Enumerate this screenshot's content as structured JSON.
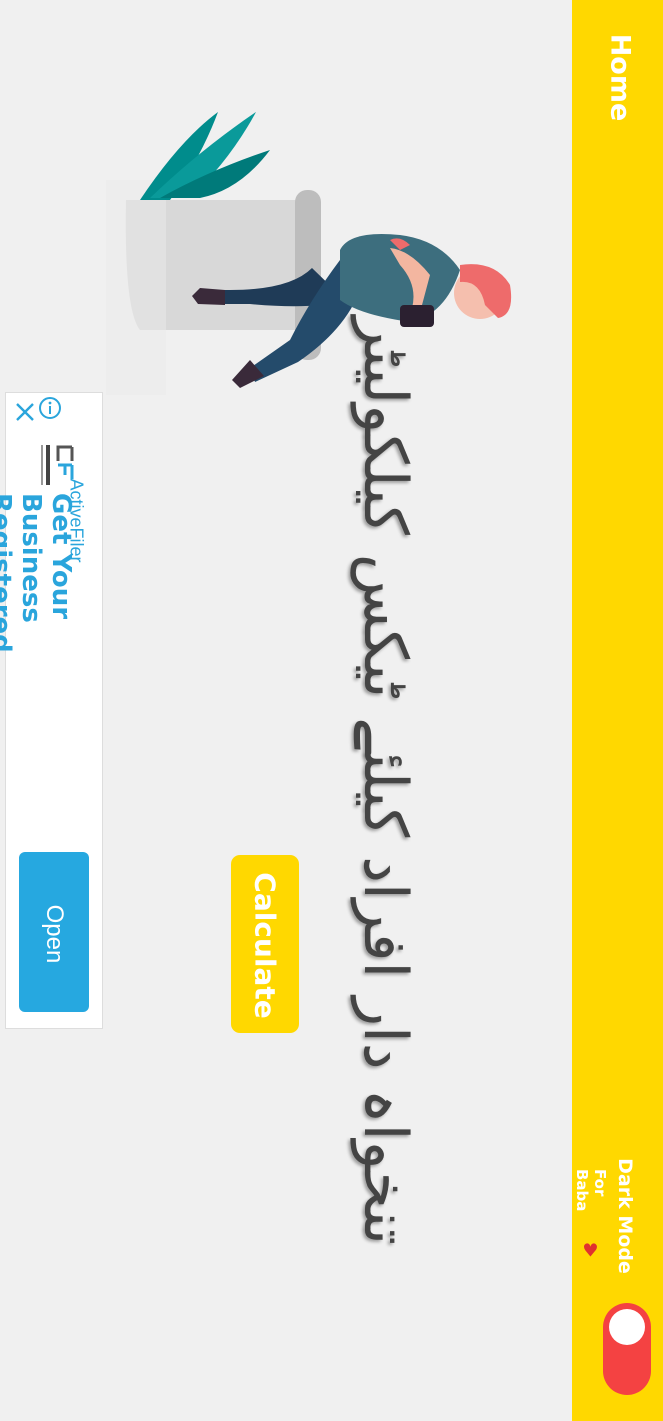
{
  "appbar": {
    "title": "Home",
    "dark_mode_label": "Dark Mode",
    "for_baba": "For Baba"
  },
  "main": {
    "question_urdu": "تنخواہ دار افراد کیلئے ٹیکس کیلکولیٹر",
    "calculate_label": "Calculate"
  },
  "ad": {
    "brand": "ActiveFiler",
    "headline": "Get Your Business Registered",
    "open_label": "Open",
    "logo_text": "activefiler"
  },
  "colors": {
    "accent": "#ffd800",
    "toggle": "#f44242",
    "ad_blue": "#26a8e0"
  },
  "icons": [
    "heart-icon",
    "close-icon",
    "info-icon",
    "activefiler-logo"
  ]
}
